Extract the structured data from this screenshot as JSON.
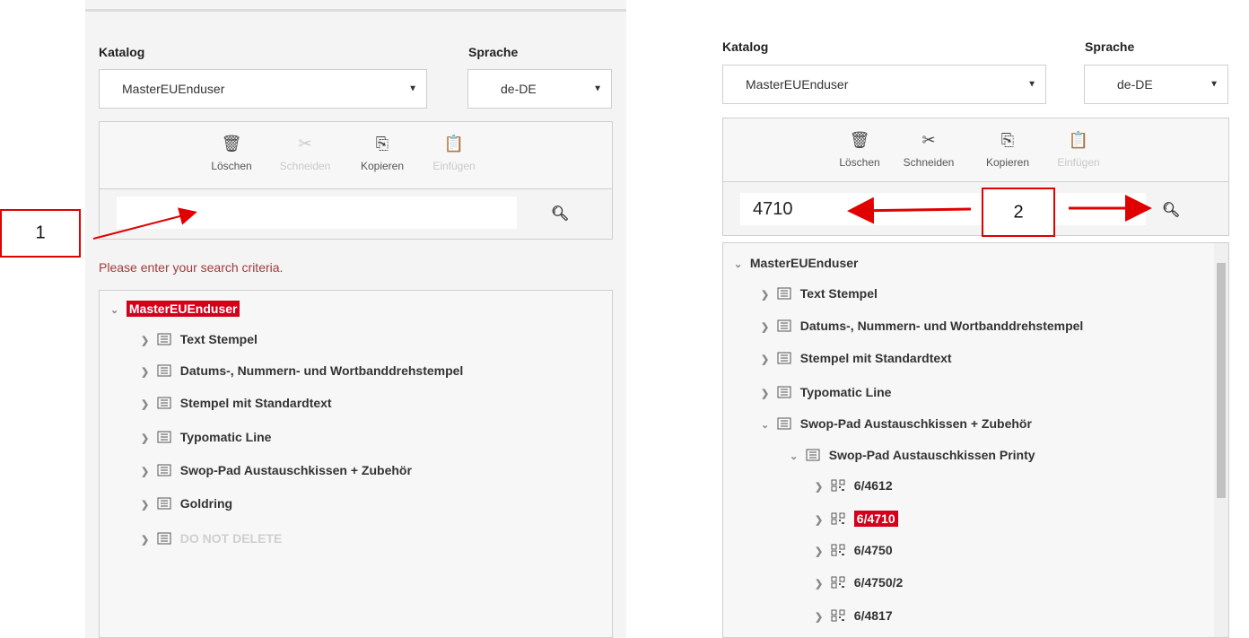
{
  "left": {
    "katalog_label": "Katalog",
    "sprache_label": "Sprache",
    "katalog_value": "MasterEUEnduser",
    "sprache_value": "de-DE",
    "toolbar": {
      "delete": "Löschen",
      "cut": "Schneiden",
      "copy": "Kopieren",
      "paste": "Einfügen"
    },
    "search_value": "",
    "error_text": "Please enter your search criteria.",
    "tree": {
      "root": "MasterEUEnduser",
      "items": [
        "Text Stempel",
        "Datums-, Nummern- und Wortbanddrehstempel",
        "Stempel mit Standardtext",
        "Typomatic Line",
        "Swop-Pad Austauschkissen + Zubehör",
        "Goldring",
        "DO NOT DELETE"
      ]
    }
  },
  "right": {
    "katalog_label": "Katalog",
    "sprache_label": "Sprache",
    "katalog_value": "MasterEUEnduser",
    "sprache_value": "de-DE",
    "toolbar": {
      "delete": "Löschen",
      "cut": "Schneiden",
      "copy": "Kopieren",
      "paste": "Einfügen"
    },
    "search_value": "4710",
    "tree": {
      "root": "MasterEUEnduser",
      "items": [
        "Text Stempel",
        "Datums-, Nummern- und Wortbanddrehstempel",
        "Stempel mit Standardtext",
        "Typomatic Line",
        "Swop-Pad Austauschkissen + Zubehör"
      ],
      "sub": "Swop-Pad Austauschkissen Printy",
      "products": [
        "6/4612",
        "6/4710",
        "6/4750",
        "6/4750/2",
        "6/4817"
      ]
    }
  },
  "annotations": {
    "callout_1": "1",
    "callout_2": "2",
    "arrow_color": "#e00000"
  },
  "colors": {
    "highlight": "#d4001a",
    "error": "#a33a3a"
  }
}
